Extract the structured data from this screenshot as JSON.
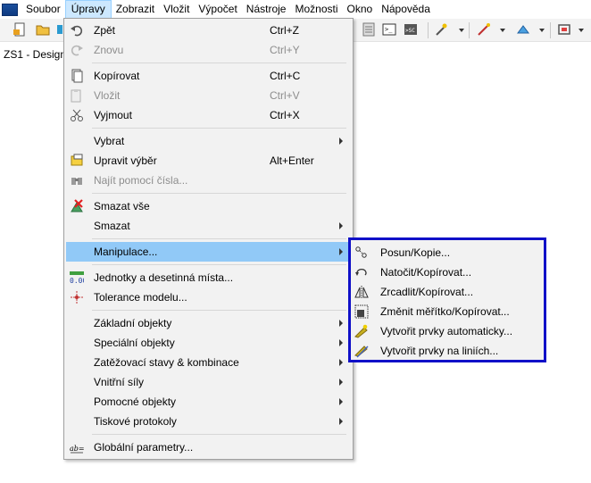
{
  "menubar": {
    "items": [
      {
        "label": "Soubor"
      },
      {
        "label": "Úpravy"
      },
      {
        "label": "Zobrazit"
      },
      {
        "label": "Vložit"
      },
      {
        "label": "Výpočet"
      },
      {
        "label": "Nástroje"
      },
      {
        "label": "Možnosti"
      },
      {
        "label": "Okno"
      },
      {
        "label": "Nápověda"
      }
    ]
  },
  "document": {
    "title": "ZS1 - Design"
  },
  "edit_menu": {
    "undo": {
      "label": "Zpět",
      "shortcut": "Ctrl+Z"
    },
    "redo": {
      "label": "Znovu",
      "shortcut": "Ctrl+Y"
    },
    "copy": {
      "label": "Kopírovat",
      "shortcut": "Ctrl+C"
    },
    "paste": {
      "label": "Vložit",
      "shortcut": "Ctrl+V"
    },
    "cut": {
      "label": "Vyjmout",
      "shortcut": "Ctrl+X"
    },
    "select": {
      "label": "Vybrat"
    },
    "edit_selection": {
      "label": "Upravit výběr",
      "shortcut": "Alt+Enter"
    },
    "find_by_number": {
      "label": "Najít pomocí čísla..."
    },
    "delete_all": {
      "label": "Smazat vše"
    },
    "delete": {
      "label": "Smazat"
    },
    "manipulate": {
      "label": "Manipulace..."
    },
    "units": {
      "label": "Jednotky a desetinná místa..."
    },
    "tolerance": {
      "label": "Tolerance modelu..."
    },
    "basic_objects": {
      "label": "Základní objekty"
    },
    "special_objects": {
      "label": "Speciální objekty"
    },
    "load_cases": {
      "label": "Zatěžovací stavy & kombinace"
    },
    "internal_forces": {
      "label": "Vnitřní síly"
    },
    "helper_objects": {
      "label": "Pomocné objekty"
    },
    "print_reports": {
      "label": "Tiskové protokoly"
    },
    "global_params": {
      "label": "Globální parametry..."
    }
  },
  "manipulate_submenu": {
    "items": [
      {
        "label": "Posun/Kopie..."
      },
      {
        "label": "Natočit/Kopírovat..."
      },
      {
        "label": "Zrcadlit/Kopírovat..."
      },
      {
        "label": "Změnit měřítko/Kopírovat..."
      },
      {
        "label": "Vytvořit prvky automaticky..."
      },
      {
        "label": "Vytvořit prvky na liniích..."
      }
    ]
  },
  "colors": {
    "menubar_active": "#cce8ff",
    "menu_bg": "#f2f2f2",
    "highlight": "#91c9f7",
    "submenu_border": "#1010c8",
    "disabled_text": "#8d8d8d"
  }
}
